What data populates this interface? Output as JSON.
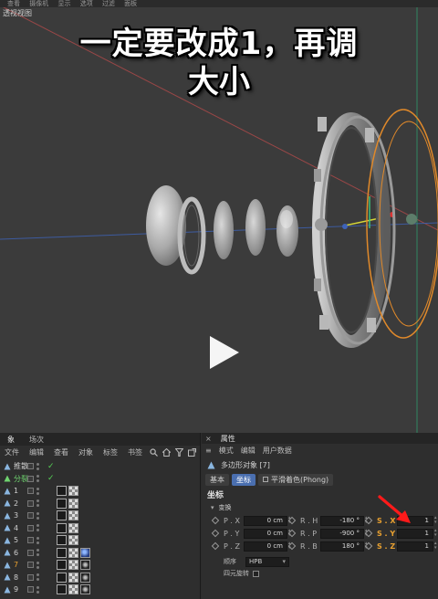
{
  "viewport": {
    "menubar_items": [
      "查看",
      "摄像机",
      "显示",
      "选项",
      "过滤",
      "面板"
    ],
    "tab_label": "透视视图",
    "caption_line1": "一定要改成1，再调",
    "caption_line2": "大小",
    "play_icon": "play-icon"
  },
  "object_manager": {
    "tabs": [
      "象",
      "场次"
    ],
    "menu": [
      "文件",
      "编辑",
      "查看",
      "对象",
      "标签",
      "书签"
    ],
    "rows": [
      {
        "name": "推散",
        "color": "normal",
        "icon": "null-object-icon",
        "tags": []
      },
      {
        "name": "分裂",
        "color": "green",
        "icon": "split-icon",
        "tags": []
      },
      {
        "name": "1",
        "color": "normal",
        "icon": "polygon-object-icon",
        "tags": [
          "phong",
          "checker"
        ]
      },
      {
        "name": "2",
        "color": "normal",
        "icon": "polygon-object-icon",
        "tags": [
          "phong",
          "checker"
        ]
      },
      {
        "name": "3",
        "color": "normal",
        "icon": "polygon-object-icon",
        "tags": [
          "phong",
          "checker"
        ]
      },
      {
        "name": "4",
        "color": "normal",
        "icon": "polygon-object-icon",
        "tags": [
          "phong",
          "checker"
        ]
      },
      {
        "name": "5",
        "color": "normal",
        "icon": "polygon-object-icon",
        "tags": [
          "phong",
          "checker"
        ]
      },
      {
        "name": "6",
        "color": "normal",
        "icon": "polygon-object-icon",
        "tags": [
          "phong",
          "checker",
          "blue"
        ]
      },
      {
        "name": "7",
        "color": "orange",
        "icon": "polygon-object-icon",
        "tags": [
          "phong",
          "checker",
          "dark"
        ]
      },
      {
        "name": "8",
        "color": "normal",
        "icon": "polygon-object-icon",
        "tags": [
          "phong",
          "checker",
          "dark"
        ]
      },
      {
        "name": "9",
        "color": "normal",
        "icon": "polygon-object-icon",
        "tags": [
          "phong",
          "checker",
          "dark"
        ]
      }
    ]
  },
  "attributes": {
    "close": "×",
    "title": "属性",
    "menu": [
      "模式",
      "编辑",
      "用户数据"
    ],
    "object_title": "多边形对象 [7]",
    "tabs": [
      "基本",
      "坐标",
      "平滑着色(Phong)"
    ],
    "active_tab": "坐标",
    "section": "坐标",
    "group": "变换",
    "rows": [
      {
        "p_label": "P . X",
        "p_value": "0 cm",
        "r_label": "R . H",
        "r_value": "-180 °",
        "s_label": "S . X",
        "s_value": "1"
      },
      {
        "p_label": "P . Y",
        "p_value": "0 cm",
        "r_label": "R . P",
        "r_value": "-900 °",
        "s_label": "S . Y",
        "s_value": "1"
      },
      {
        "p_label": "P . Z",
        "p_value": "0 cm",
        "r_label": "R . B",
        "r_value": "180 °",
        "s_label": "S . Z",
        "s_value": "1"
      }
    ],
    "order_label": "顺序",
    "order_value": "HPB",
    "quaternion_label": "四元旋转"
  }
}
